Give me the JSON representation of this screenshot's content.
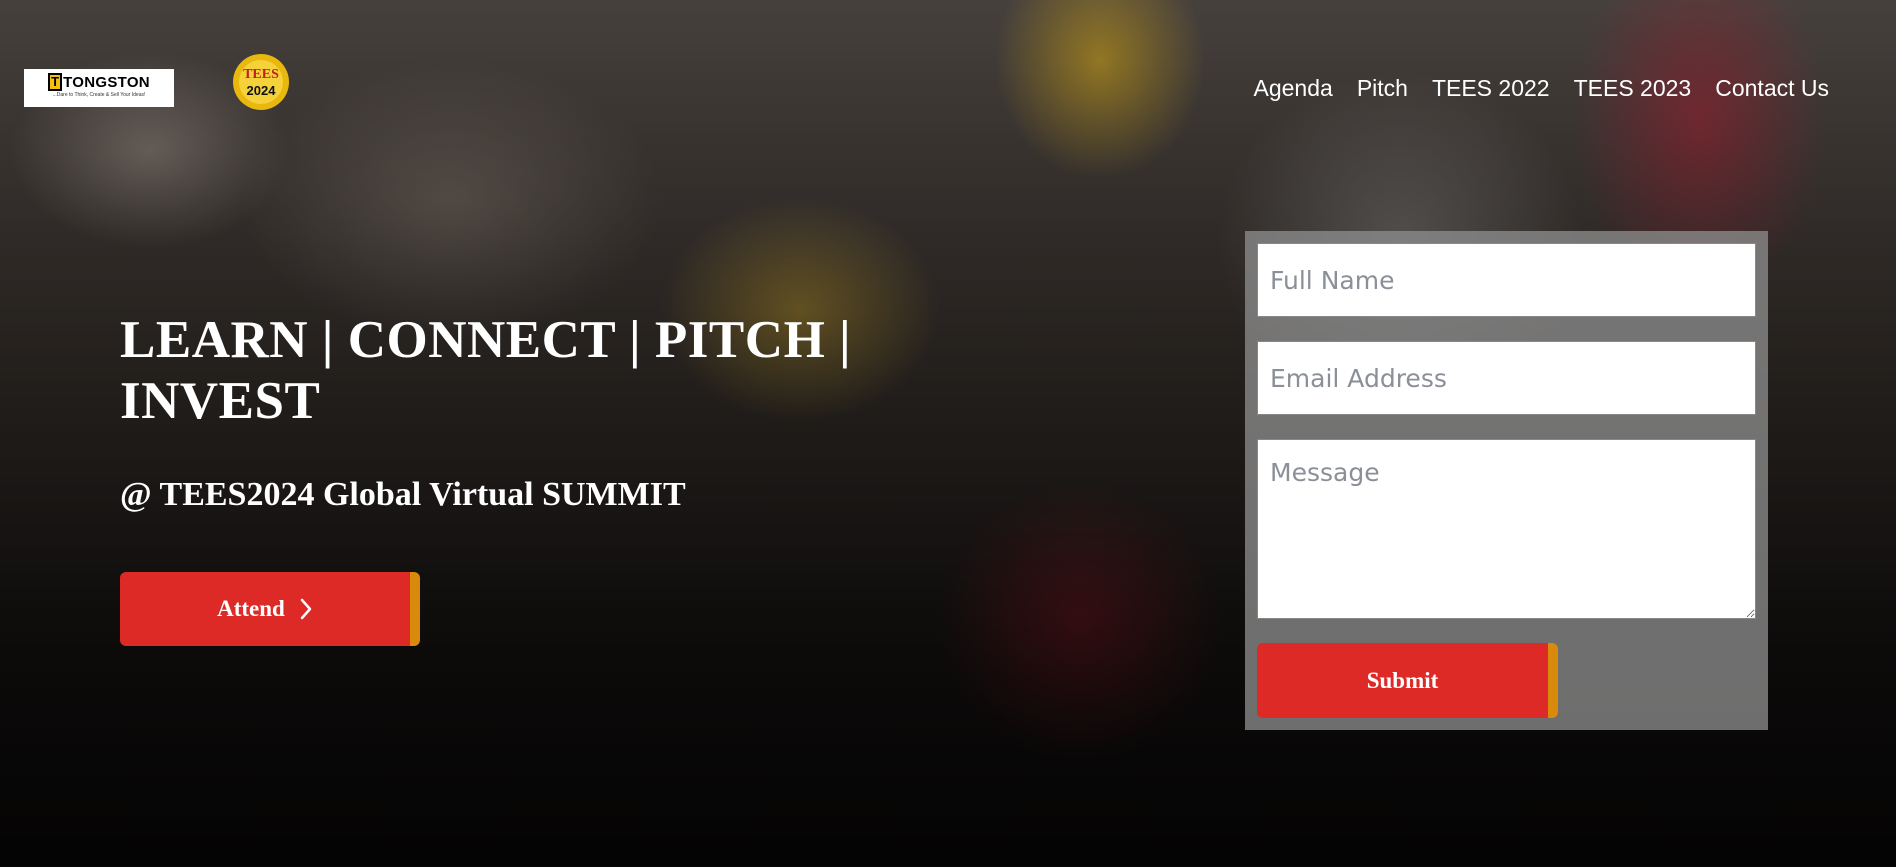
{
  "brand": {
    "logo_text": "TONGSTON",
    "logo_tagline": "...Dare to Think, Create & Sell Your Ideas!",
    "event_logo_text": "TEES 2024"
  },
  "nav": {
    "items": [
      {
        "label": "Agenda"
      },
      {
        "label": "Pitch"
      },
      {
        "label": "TEES 2022"
      },
      {
        "label": "TEES 2023"
      },
      {
        "label": "Contact Us"
      }
    ]
  },
  "hero": {
    "headline": "LEARN | CONNECT | PITCH | INVEST",
    "subheadline": "@ TEES2024 Global Virtual SUMMIT",
    "attend_label": "Attend",
    "attend_icon": "chevron-right-icon"
  },
  "form": {
    "full_name_placeholder": "Full Name",
    "email_placeholder": "Email Address",
    "message_placeholder": "Message",
    "submit_label": "Submit"
  },
  "colors": {
    "accent_red": "#de2a26",
    "accent_orange": "#d98a0a",
    "text": "#ffffff"
  }
}
